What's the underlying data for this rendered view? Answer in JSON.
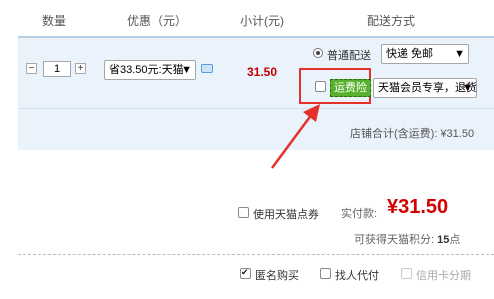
{
  "header": {
    "quantity": "数量",
    "discount": "优惠（元）",
    "subtotal": "小计(元)",
    "delivery": "配送方式"
  },
  "order": {
    "minus_label": "−",
    "plus_label": "+",
    "quantity_value": "1",
    "discount_select": "省33.50元:天猫",
    "subtotal_value": "31.50",
    "delivery_option": "普通配送",
    "delivery_select": "快递 免邮",
    "insurance_label": "运费险",
    "member_select": "天猫会员专享，退货"
  },
  "summary": {
    "store_total": "店铺合计(含运费): ¥31.50"
  },
  "checkout": {
    "coupon_label": "使用天猫点券",
    "pay_label": "实付款:",
    "pay_value": "¥31.50",
    "points_prefix": "可获得天猫积分:",
    "points_value": "15",
    "points_suffix": "点",
    "anonymous_label": "匿名购买",
    "proxy_label": "找人代付",
    "installment_label": "信用卡分期"
  },
  "colors": {
    "accent_red": "#d40000",
    "highlight_border": "#e6312b",
    "insurance_green": "#58b22d",
    "row_bg": "#eaf2fb"
  }
}
